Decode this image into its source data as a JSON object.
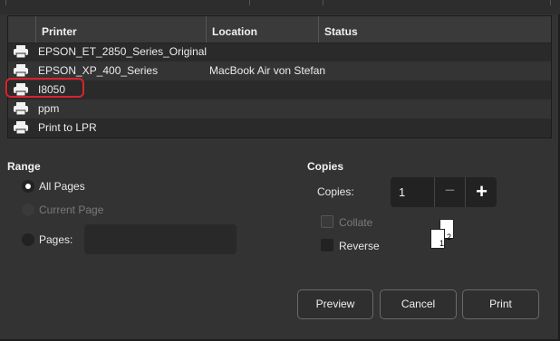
{
  "printer_list": {
    "columns": [
      "Printer",
      "Location",
      "Status"
    ],
    "rows": [
      {
        "name": "EPSON_ET_2850_Series_Original",
        "location": "",
        "status": "",
        "icon": "printer-icon"
      },
      {
        "name": "EPSON_XP_400_Series",
        "location": "MacBook Air von Stefan",
        "status": "",
        "icon": "printer-icon"
      },
      {
        "name": "I8050",
        "location": "",
        "status": "",
        "icon": "printer-icon",
        "selected": true
      },
      {
        "name": "ppm",
        "location": "",
        "status": "",
        "icon": "printer-icon"
      },
      {
        "name": "Print to LPR",
        "location": "",
        "status": "",
        "icon": "printer-icon"
      }
    ]
  },
  "range": {
    "title": "Range",
    "options": [
      {
        "label": "All Pages",
        "checked": true,
        "disabled": false
      },
      {
        "label": "Current Page",
        "checked": false,
        "disabled": true
      },
      {
        "label": "Pages:",
        "checked": false,
        "disabled": false
      }
    ],
    "pages_value": ""
  },
  "copies": {
    "title": "Copies",
    "label": "Copies:",
    "value": "1",
    "minus_icon": "minus-icon",
    "plus_icon": "plus-icon",
    "collate_label": "Collate",
    "collate_checked": false,
    "collate_disabled": true,
    "reverse_label": "Reverse",
    "reverse_checked": false,
    "collate_pages": [
      "1",
      "2"
    ]
  },
  "buttons": {
    "preview": "Preview",
    "cancel": "Cancel",
    "print": "Print"
  },
  "colors": {
    "background": "#333333",
    "highlight_ring": "#d9232e"
  }
}
